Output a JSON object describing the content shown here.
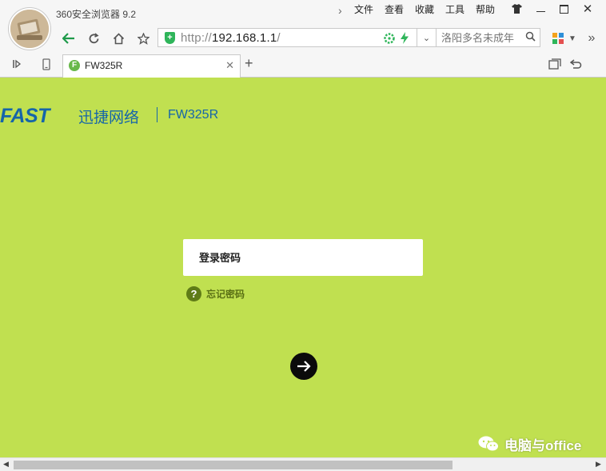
{
  "browser": {
    "title": "360安全浏览器 9.2",
    "menu": [
      "文件",
      "查看",
      "收藏",
      "工具",
      "帮助"
    ],
    "address": {
      "protocol": "http://",
      "host": "192.168.1.1",
      "path": "/"
    },
    "search_placeholder": "洛阳多名未成年",
    "tab": {
      "title": "FW325R"
    }
  },
  "page": {
    "brand_logo": "FAST",
    "brand_name": "迅捷网络",
    "model": "FW325R",
    "password_placeholder": "登录密码",
    "forgot_label": "忘记密码"
  },
  "watermark": "电脑与office",
  "colors": {
    "page_background": "#c0e050",
    "brand_blue": "#1565a9",
    "help_icon": "#5f7b17",
    "login_button": "#0b0b0b",
    "security_green": "#2fb55a"
  },
  "icons": {
    "nav": [
      "back-arrow-icon",
      "refresh-icon",
      "home-icon",
      "star-icon"
    ],
    "address": [
      "shield-icon",
      "speed-icon",
      "lightning-icon"
    ],
    "toolbar_right": [
      "apps-grid-icon",
      "more-chevron-icon"
    ],
    "tab_row": [
      "sidebar-toggle-icon",
      "phone-icon",
      "restore-tabs-icon",
      "undo-icon"
    ]
  }
}
